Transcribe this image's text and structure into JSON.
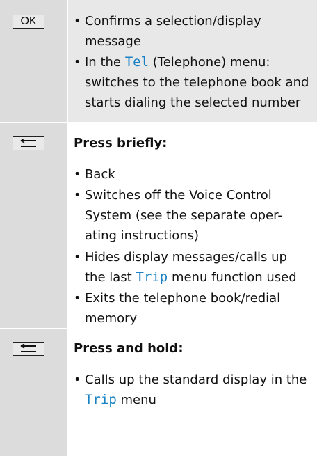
{
  "rows": [
    {
      "key_label": "OK",
      "items": [
        {
          "text": "Confirms a selection/display message"
        },
        {
          "pre": "In the ",
          "code": "Tel",
          "post": " (Telephone) menu: switches to the telephone book and starts dialing the selected number"
        }
      ]
    },
    {
      "key_icon": "back-arrow-icon",
      "heading": "Press briefly:",
      "items": [
        {
          "text": "Back"
        },
        {
          "text": "Switches off the Voice Control System (see the separate oper-ating instructions)"
        },
        {
          "pre": "Hides display messages/calls up the last ",
          "code": "Trip",
          "post": " menu function used"
        },
        {
          "text": "Exits the telephone book/redial memory"
        }
      ]
    },
    {
      "key_icon": "back-arrow-icon",
      "heading": "Press and hold:",
      "items": [
        {
          "pre": "Calls up the standard display in the ",
          "code": "Trip",
          "post": " menu"
        }
      ]
    }
  ],
  "colors": {
    "highlight": "#1a82c4",
    "shade": "#dcdcdc"
  },
  "bullet_char": "•"
}
